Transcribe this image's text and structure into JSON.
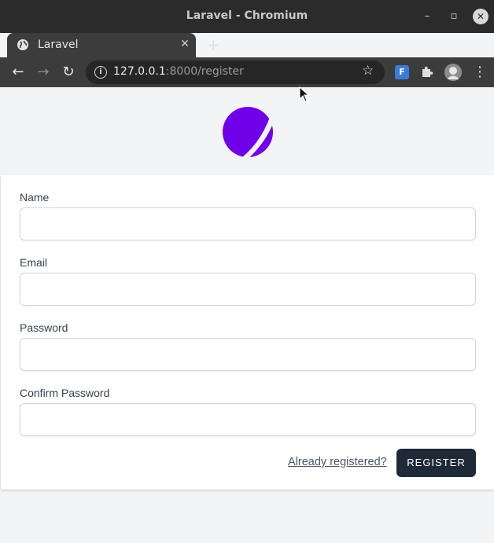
{
  "window": {
    "title": "Laravel - Chromium"
  },
  "tab": {
    "title": "Laravel"
  },
  "toolbar": {
    "url_host": "127.0.0.1",
    "url_path": ":8000/register",
    "extension_label": "F"
  },
  "form": {
    "name_label": "Name",
    "email_label": "Email",
    "password_label": "Password",
    "confirm_password_label": "Confirm Password",
    "already_registered_link": "Already registered?",
    "register_button": "REGISTER"
  },
  "colors": {
    "logo": "#7000e8",
    "button": "#1f2937"
  }
}
